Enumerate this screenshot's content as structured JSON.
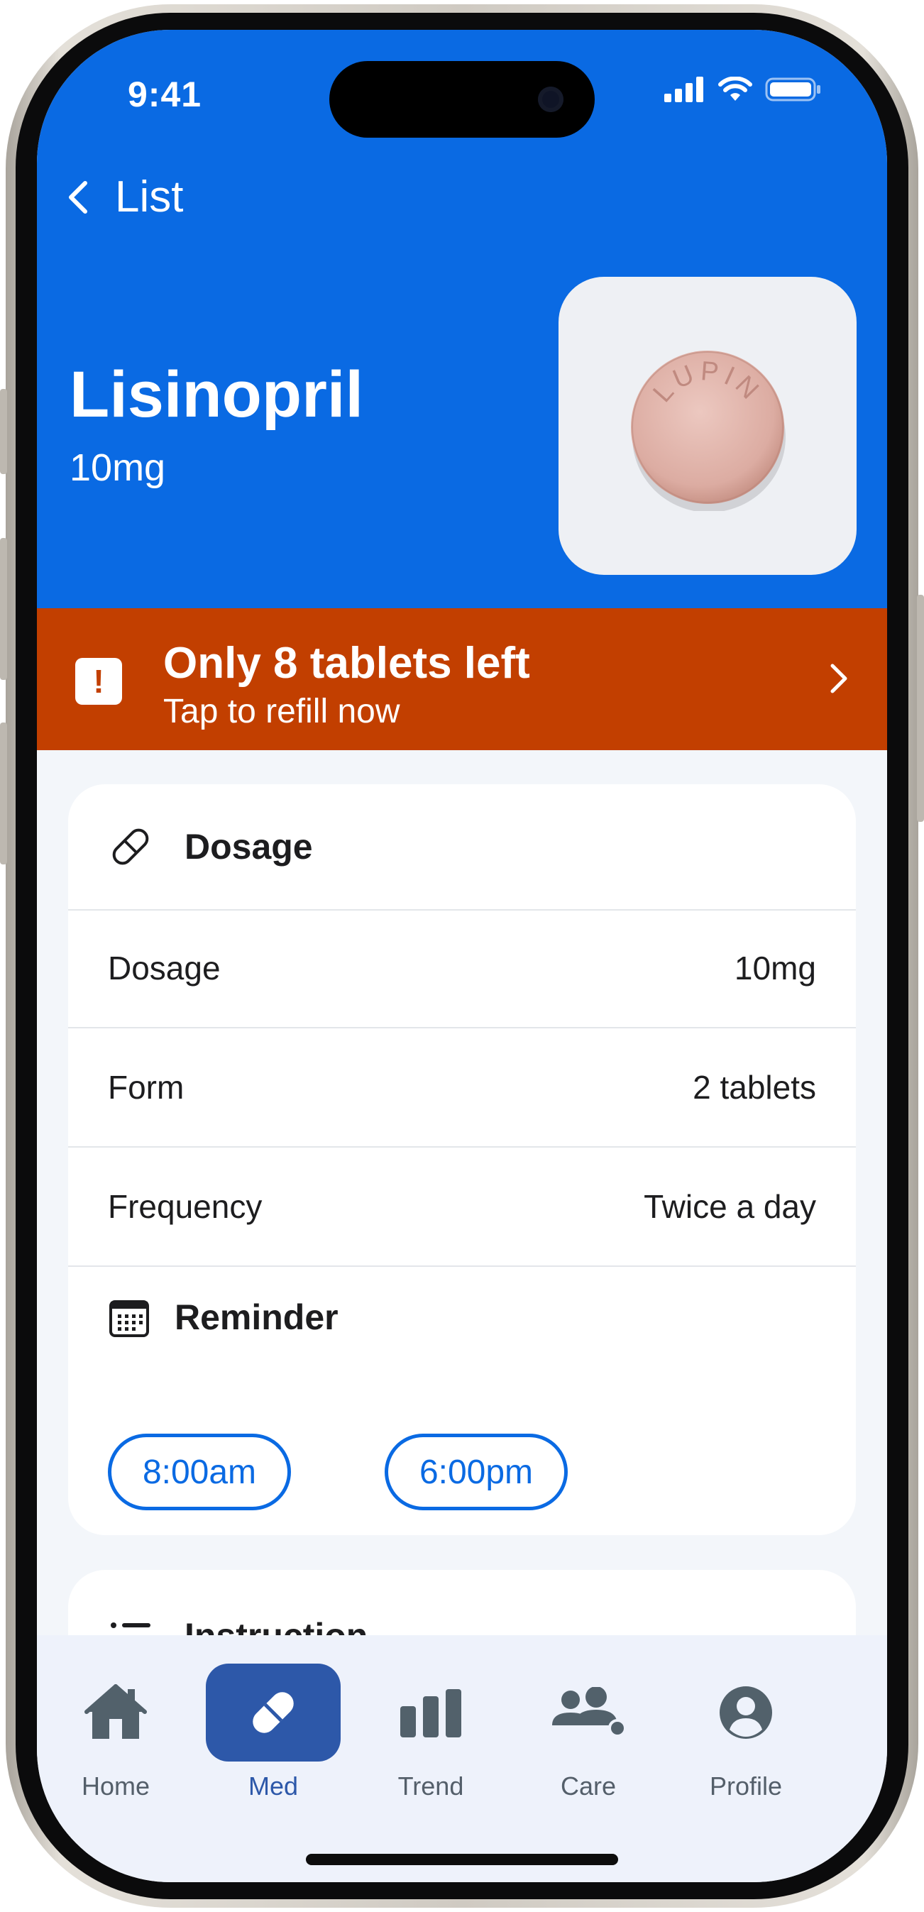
{
  "status_bar": {
    "time": "9:41"
  },
  "nav": {
    "back_label": "List"
  },
  "medication": {
    "name": "Lisinopril",
    "strength": "10mg",
    "imprint": "LUPIN"
  },
  "alert": {
    "title": "Only 8 tablets left",
    "subtitle": "Tap to refill now",
    "icon": "exclamation-icon",
    "color": "#c23f00"
  },
  "dosage_card": {
    "title": "Dosage",
    "rows": [
      {
        "label": "Dosage",
        "value": "10mg"
      },
      {
        "label": "Form",
        "value": "2 tablets"
      },
      {
        "label": "Frequency",
        "value": "Twice a day"
      }
    ],
    "reminder_title": "Reminder",
    "reminder_times": [
      "8:00am",
      "6:00pm"
    ]
  },
  "instruction_card": {
    "title": "Instruction"
  },
  "tabbar": {
    "items": [
      {
        "label": "Home",
        "icon": "house-icon",
        "active": false
      },
      {
        "label": "Med",
        "icon": "pill-icon",
        "active": true
      },
      {
        "label": "Trend",
        "icon": "bar-chart-icon",
        "active": false
      },
      {
        "label": "Care",
        "icon": "people-icon",
        "active": false
      },
      {
        "label": "Profile",
        "icon": "person-circle-icon",
        "active": false
      }
    ]
  },
  "colors": {
    "primary": "#0a6ae3",
    "alert": "#c23f00",
    "tab_active": "#2d58a9",
    "background": "#f3f6fa"
  }
}
